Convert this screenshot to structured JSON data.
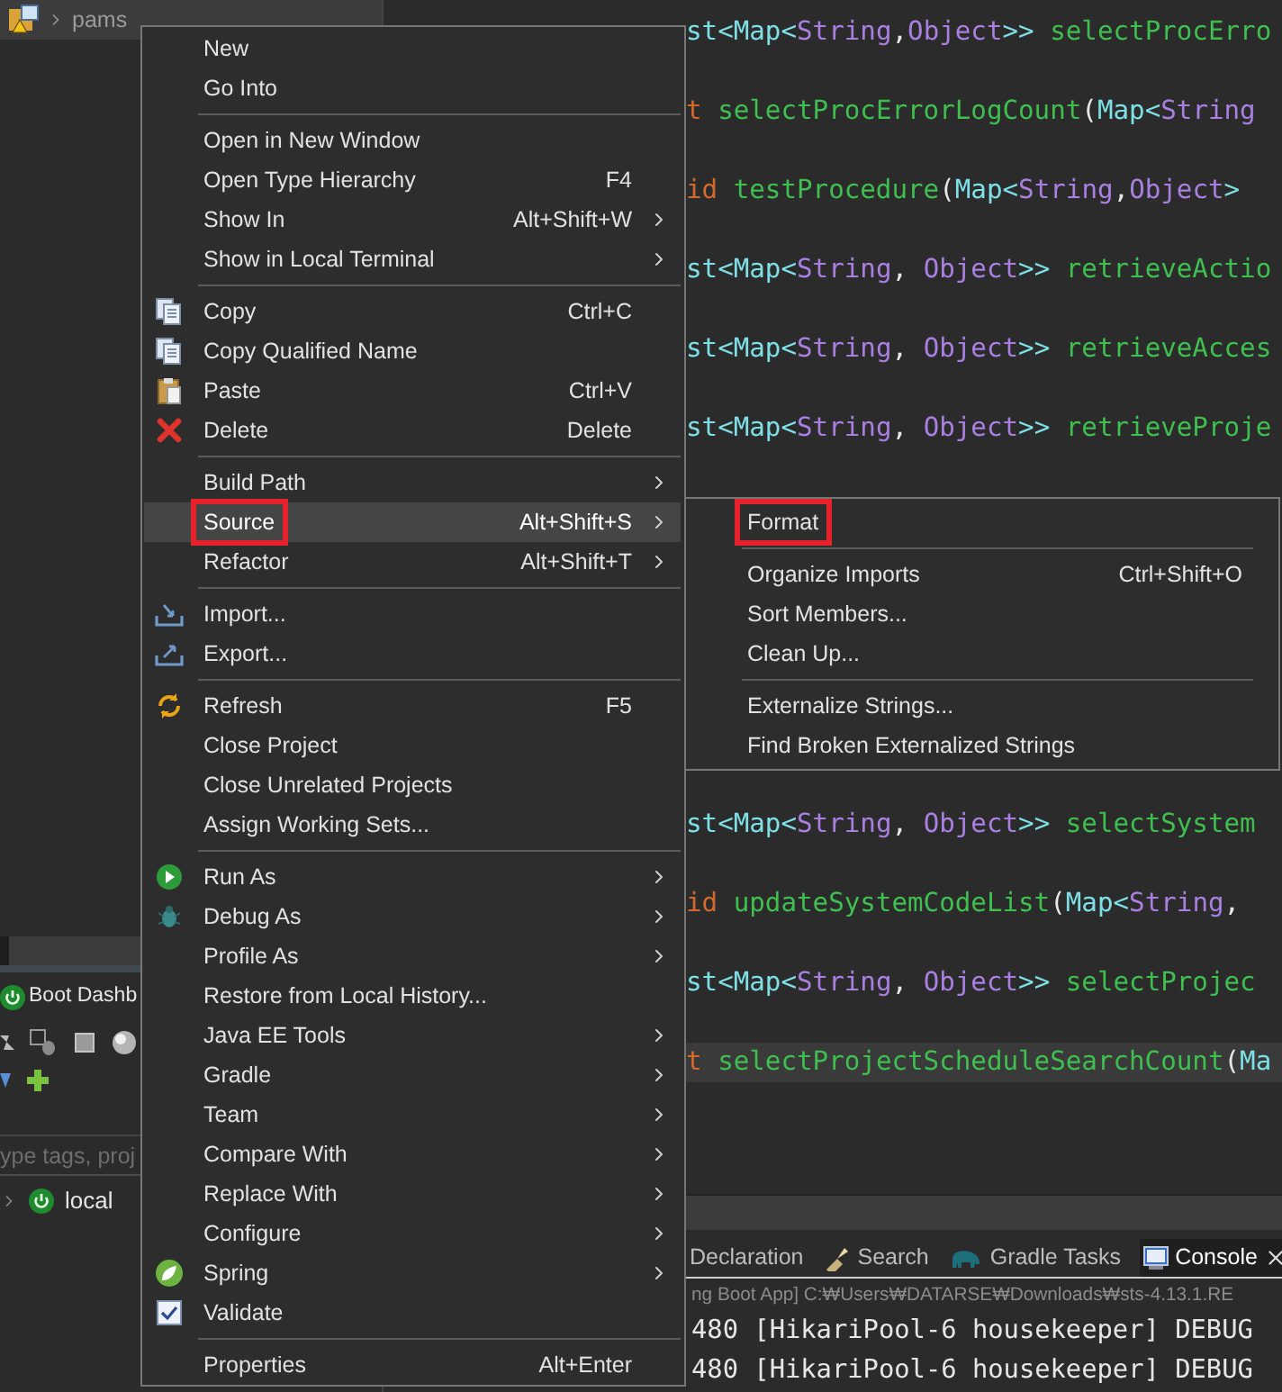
{
  "explorer": {
    "tree_item": {
      "label": "pams",
      "selected": true
    },
    "boot_dashboard": {
      "tab_label": "Boot Dashb",
      "filter_placeholder": "ype tags, proj",
      "targets": [
        {
          "label": "local",
          "expanded": false
        }
      ]
    }
  },
  "editor": {
    "code_lines_upper": [
      {
        "current": false,
        "tokens": [
          {
            "text": "st<",
            "kind": "type"
          },
          {
            "text": "Map",
            "kind": "class"
          },
          {
            "text": "<",
            "kind": "type"
          },
          {
            "text": "String",
            "kind": "generic"
          },
          {
            "text": ",",
            "kind": "plain"
          },
          {
            "text": "Object",
            "kind": "generic"
          },
          {
            "text": ">> ",
            "kind": "type"
          },
          {
            "text": "selectProcErro",
            "kind": "method"
          }
        ]
      },
      {
        "current": false,
        "tokens": [
          {
            "text": "t ",
            "kind": "keyword"
          },
          {
            "text": "selectProcErrorLogCount",
            "kind": "method"
          },
          {
            "text": "(",
            "kind": "plain"
          },
          {
            "text": "Map",
            "kind": "class"
          },
          {
            "text": "<",
            "kind": "type"
          },
          {
            "text": "String",
            "kind": "generic"
          }
        ]
      },
      {
        "current": false,
        "tokens": [
          {
            "text": "id ",
            "kind": "keyword"
          },
          {
            "text": "testProcedure",
            "kind": "method"
          },
          {
            "text": "(",
            "kind": "plain"
          },
          {
            "text": "Map",
            "kind": "class"
          },
          {
            "text": "<",
            "kind": "type"
          },
          {
            "text": "String",
            "kind": "generic"
          },
          {
            "text": ",",
            "kind": "plain"
          },
          {
            "text": "Object",
            "kind": "generic"
          },
          {
            "text": "> ",
            "kind": "type"
          }
        ]
      },
      {
        "current": false,
        "tokens": [
          {
            "text": "st<",
            "kind": "type"
          },
          {
            "text": "Map",
            "kind": "class"
          },
          {
            "text": "<",
            "kind": "type"
          },
          {
            "text": "String",
            "kind": "generic"
          },
          {
            "text": ", ",
            "kind": "plain"
          },
          {
            "text": "Object",
            "kind": "generic"
          },
          {
            "text": ">> ",
            "kind": "type"
          },
          {
            "text": "retrieveActio",
            "kind": "method"
          }
        ]
      },
      {
        "current": false,
        "tokens": [
          {
            "text": "st<",
            "kind": "type"
          },
          {
            "text": "Map",
            "kind": "class"
          },
          {
            "text": "<",
            "kind": "type"
          },
          {
            "text": "String",
            "kind": "generic"
          },
          {
            "text": ", ",
            "kind": "plain"
          },
          {
            "text": "Object",
            "kind": "generic"
          },
          {
            "text": ">> ",
            "kind": "type"
          },
          {
            "text": "retrieveAcces",
            "kind": "method"
          }
        ]
      },
      {
        "current": false,
        "tokens": [
          {
            "text": "st<",
            "kind": "type"
          },
          {
            "text": "Map",
            "kind": "class"
          },
          {
            "text": "<",
            "kind": "type"
          },
          {
            "text": "String",
            "kind": "generic"
          },
          {
            "text": ", ",
            "kind": "plain"
          },
          {
            "text": "Object",
            "kind": "generic"
          },
          {
            "text": ">> ",
            "kind": "type"
          },
          {
            "text": "retrieveProje",
            "kind": "method"
          }
        ]
      }
    ],
    "code_lines_lower": [
      {
        "current": false,
        "tokens": [
          {
            "text": "st<",
            "kind": "type"
          },
          {
            "text": "Map",
            "kind": "class"
          },
          {
            "text": "<",
            "kind": "type"
          },
          {
            "text": "String",
            "kind": "generic"
          },
          {
            "text": ", ",
            "kind": "plain"
          },
          {
            "text": "Object",
            "kind": "generic"
          },
          {
            "text": ">> ",
            "kind": "type"
          },
          {
            "text": "selectSystem",
            "kind": "method"
          }
        ]
      },
      {
        "current": false,
        "tokens": [
          {
            "text": "id ",
            "kind": "keyword"
          },
          {
            "text": "updateSystemCodeList",
            "kind": "method"
          },
          {
            "text": "(",
            "kind": "plain"
          },
          {
            "text": "Map",
            "kind": "class"
          },
          {
            "text": "<",
            "kind": "type"
          },
          {
            "text": "String",
            "kind": "generic"
          },
          {
            "text": ", ",
            "kind": "plain"
          }
        ]
      },
      {
        "current": false,
        "tokens": [
          {
            "text": "st<",
            "kind": "type"
          },
          {
            "text": "Map",
            "kind": "class"
          },
          {
            "text": "<",
            "kind": "type"
          },
          {
            "text": "String",
            "kind": "generic"
          },
          {
            "text": ", ",
            "kind": "plain"
          },
          {
            "text": "Object",
            "kind": "generic"
          },
          {
            "text": ">> ",
            "kind": "type"
          },
          {
            "text": "selectProjec",
            "kind": "method"
          }
        ]
      },
      {
        "current": true,
        "tokens": [
          {
            "text": "t ",
            "kind": "keyword"
          },
          {
            "text": "selectProjectScheduleSearchCount",
            "kind": "method"
          },
          {
            "text": "(",
            "kind": "plain"
          },
          {
            "text": "Ma",
            "kind": "class"
          }
        ]
      }
    ]
  },
  "console": {
    "tabs": [
      {
        "label": "Declaration",
        "selected": false
      },
      {
        "label": "Search",
        "selected": false
      },
      {
        "label": "Gradle Tasks",
        "selected": false
      },
      {
        "label": "Console",
        "selected": true
      }
    ],
    "launch_path": "ng Boot App] C:₩Users₩DATARSE₩Downloads₩sts-4.13.1.RE",
    "lines": [
      "480 [HikariPool-6 housekeeper] DEBUG",
      "480 [HikariPool-6 housekeeper] DEBUG"
    ]
  },
  "context_menu": {
    "items": [
      {
        "kind": "item",
        "label": "New",
        "submenu": false,
        "selected": false,
        "annotated": false
      },
      {
        "kind": "item",
        "label": "Go Into",
        "submenu": false,
        "selected": false,
        "annotated": false
      },
      {
        "kind": "separator"
      },
      {
        "kind": "item",
        "label": "Open in New Window",
        "submenu": false,
        "selected": false,
        "annotated": false
      },
      {
        "kind": "item",
        "label": "Open Type Hierarchy",
        "shortcut": "F4",
        "submenu": false,
        "selected": false,
        "annotated": false
      },
      {
        "kind": "item",
        "label": "Show In",
        "shortcut": "Alt+Shift+W",
        "submenu": true,
        "selected": false,
        "annotated": false
      },
      {
        "kind": "item",
        "label": "Show in Local Terminal",
        "submenu": true,
        "selected": false,
        "annotated": false
      },
      {
        "kind": "separator"
      },
      {
        "kind": "item",
        "label": "Copy",
        "shortcut": "Ctrl+C",
        "submenu": false,
        "selected": false,
        "annotated": false
      },
      {
        "kind": "item",
        "label": "Copy Qualified Name",
        "submenu": false,
        "selected": false,
        "annotated": false
      },
      {
        "kind": "item",
        "label": "Paste",
        "shortcut": "Ctrl+V",
        "submenu": false,
        "selected": false,
        "annotated": false
      },
      {
        "kind": "item",
        "label": "Delete",
        "shortcut": "Delete",
        "submenu": false,
        "selected": false,
        "annotated": false
      },
      {
        "kind": "separator"
      },
      {
        "kind": "item",
        "label": "Build Path",
        "submenu": true,
        "selected": false,
        "annotated": false
      },
      {
        "kind": "item",
        "label": "Source",
        "shortcut": "Alt+Shift+S",
        "submenu": true,
        "selected": true,
        "annotated": true
      },
      {
        "kind": "item",
        "label": "Refactor",
        "shortcut": "Alt+Shift+T",
        "submenu": true,
        "selected": false,
        "annotated": false
      },
      {
        "kind": "separator"
      },
      {
        "kind": "item",
        "label": "Import...",
        "submenu": false,
        "selected": false,
        "annotated": false
      },
      {
        "kind": "item",
        "label": "Export...",
        "submenu": false,
        "selected": false,
        "annotated": false
      },
      {
        "kind": "separator"
      },
      {
        "kind": "item",
        "label": "Refresh",
        "shortcut": "F5",
        "submenu": false,
        "selected": false,
        "annotated": false
      },
      {
        "kind": "item",
        "label": "Close Project",
        "submenu": false,
        "selected": false,
        "annotated": false
      },
      {
        "kind": "item",
        "label": "Close Unrelated Projects",
        "submenu": false,
        "selected": false,
        "annotated": false
      },
      {
        "kind": "item",
        "label": "Assign Working Sets...",
        "submenu": false,
        "selected": false,
        "annotated": false
      },
      {
        "kind": "separator"
      },
      {
        "kind": "item",
        "label": "Run As",
        "submenu": true,
        "selected": false,
        "annotated": false
      },
      {
        "kind": "item",
        "label": "Debug As",
        "submenu": true,
        "selected": false,
        "annotated": false
      },
      {
        "kind": "item",
        "label": "Profile As",
        "submenu": true,
        "selected": false,
        "annotated": false
      },
      {
        "kind": "item",
        "label": "Restore from Local History...",
        "submenu": false,
        "selected": false,
        "annotated": false
      },
      {
        "kind": "item",
        "label": "Java EE Tools",
        "submenu": true,
        "selected": false,
        "annotated": false
      },
      {
        "kind": "item",
        "label": "Gradle",
        "submenu": true,
        "selected": false,
        "annotated": false
      },
      {
        "kind": "item",
        "label": "Team",
        "submenu": true,
        "selected": false,
        "annotated": false
      },
      {
        "kind": "item",
        "label": "Compare With",
        "submenu": true,
        "selected": false,
        "annotated": false
      },
      {
        "kind": "item",
        "label": "Replace With",
        "submenu": true,
        "selected": false,
        "annotated": false
      },
      {
        "kind": "item",
        "label": "Configure",
        "submenu": true,
        "selected": false,
        "annotated": false
      },
      {
        "kind": "item",
        "label": "Spring",
        "submenu": true,
        "selected": false,
        "annotated": false
      },
      {
        "kind": "item",
        "label": "Validate",
        "submenu": false,
        "selected": false,
        "annotated": false
      },
      {
        "kind": "separator"
      },
      {
        "kind": "item",
        "label": "Properties",
        "shortcut": "Alt+Enter",
        "submenu": false,
        "selected": false,
        "annotated": false
      }
    ]
  },
  "source_submenu": {
    "items": [
      {
        "kind": "item",
        "label": "Format",
        "selected": false,
        "annotated": true
      },
      {
        "kind": "separator"
      },
      {
        "kind": "item",
        "label": "Organize Imports",
        "shortcut": "Ctrl+Shift+O",
        "selected": false,
        "annotated": false
      },
      {
        "kind": "item",
        "label": "Sort Members...",
        "selected": false,
        "annotated": false
      },
      {
        "kind": "item",
        "label": "Clean Up...",
        "selected": false,
        "annotated": false
      },
      {
        "kind": "separator"
      },
      {
        "kind": "item",
        "label": "Externalize Strings...",
        "selected": false,
        "annotated": false
      },
      {
        "kind": "item",
        "label": "Find Broken Externalized Strings",
        "selected": false,
        "annotated": false
      }
    ]
  }
}
